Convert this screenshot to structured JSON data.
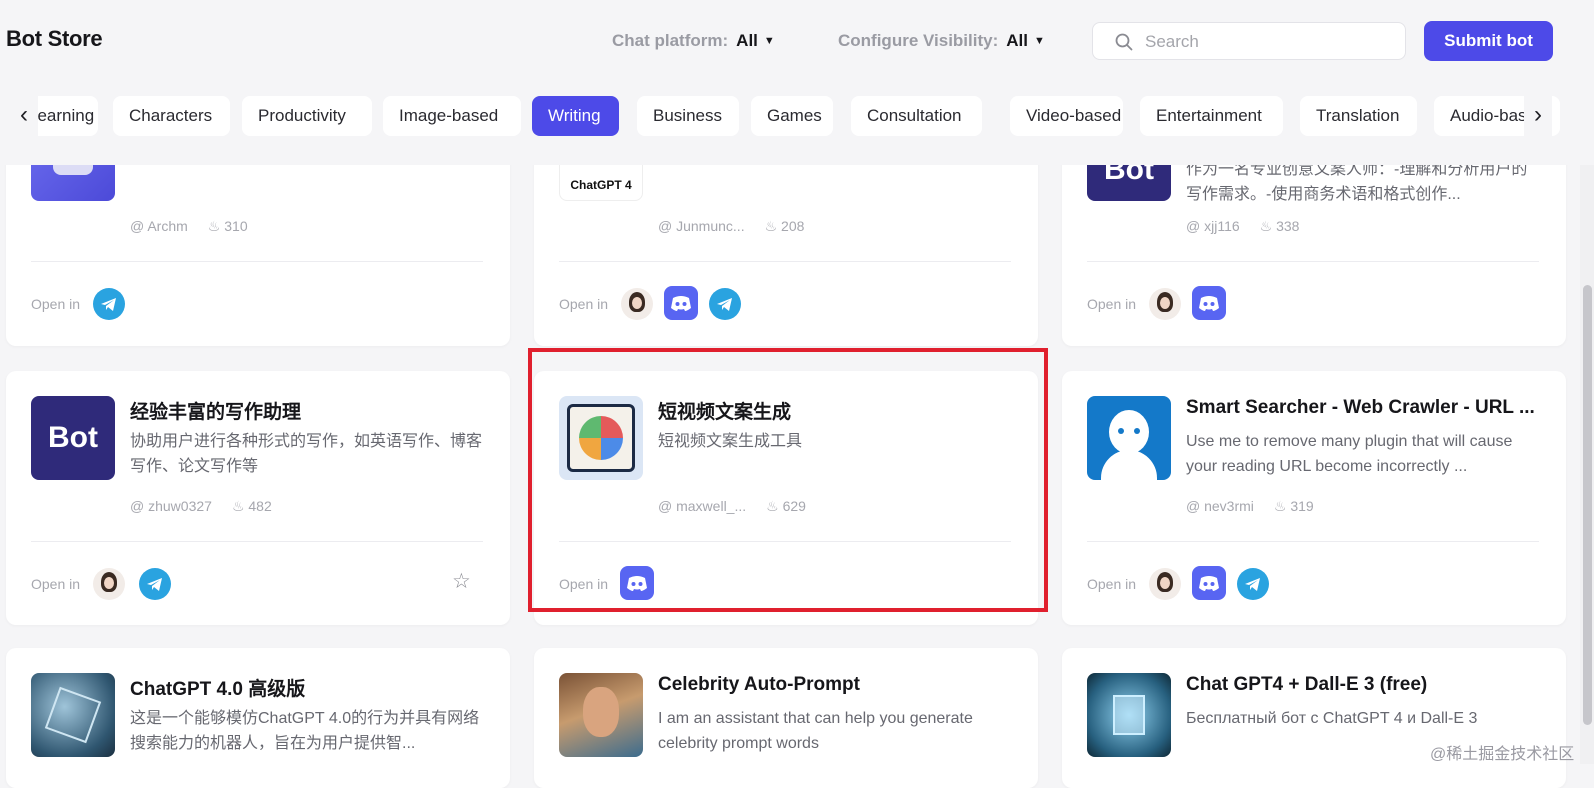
{
  "header": {
    "title": "Bot Store",
    "platform_filter": {
      "label": "Chat platform:",
      "value": "All"
    },
    "visibility_filter": {
      "label": "Configure Visibility:",
      "value": "All"
    },
    "search_placeholder": "Search",
    "submit_label": "Submit bot"
  },
  "categories": [
    {
      "label": "Learning"
    },
    {
      "label": "Characters"
    },
    {
      "label": "Productivity"
    },
    {
      "label": "Image-based"
    },
    {
      "label": "Writing",
      "active": true
    },
    {
      "label": "Business"
    },
    {
      "label": "Games"
    },
    {
      "label": "Consultation"
    },
    {
      "label": "Video-based"
    },
    {
      "label": "Entertainment"
    },
    {
      "label": "Translation"
    },
    {
      "label": "Audio-based"
    }
  ],
  "open_in_label": "Open in",
  "cards": [
    {
      "title": "",
      "description": "",
      "author": "Archm",
      "uses": "310",
      "platforms": [
        "telegram"
      ]
    },
    {
      "title": "",
      "description": "",
      "thumb_label": "ChatGPT 4",
      "author": "Junmunc...",
      "uses": "208",
      "platforms": [
        "avatar",
        "discord",
        "telegram"
      ]
    },
    {
      "title": "",
      "description": "作为一名专业创意文案人师：-理解和分析用户的写作需求。-使用商务术语和格式创作...",
      "thumb_label": "Bot",
      "author": "xjj116",
      "uses": "338",
      "platforms": [
        "avatar",
        "discord"
      ]
    },
    {
      "title": "经验丰富的写作助理",
      "description": "协助用户进行各种形式的写作，如英语写作、博客写作、论文写作等",
      "thumb_label": "Bot",
      "author": "zhuw0327",
      "uses": "482",
      "platforms": [
        "avatar",
        "telegram"
      ]
    },
    {
      "title": "短视频文案生成",
      "description": "短视频文案生成工具",
      "author": "maxwell_...",
      "uses": "629",
      "platforms": [
        "discord"
      ]
    },
    {
      "title": "Smart Searcher - Web Crawler - URL ...",
      "description": "Use me to remove many plugin that will cause your reading URL become incorrectly ...",
      "author": "nev3rmi",
      "uses": "319",
      "platforms": [
        "avatar",
        "discord",
        "telegram"
      ]
    },
    {
      "title": "ChatGPT 4.0 高级版",
      "description": "这是一个能够模仿ChatGPT 4.0的行为并具有网络搜索能力的机器人，旨在为用户提供智..."
    },
    {
      "title": "Celebrity Auto-Prompt",
      "description": "I am an assistant that can help you generate celebrity prompt words"
    },
    {
      "title": "Chat GPT4 + Dall-E 3 (free)",
      "description": "Бесплатный бот с ChatGPT 4 и Dall-E 3"
    }
  ],
  "watermark": "@稀土掘金技术社区",
  "colors": {
    "accent": "#4d4ae8",
    "highlight": "#e0202e",
    "telegram": "#2aa3e0",
    "discord": "#5865f2"
  }
}
